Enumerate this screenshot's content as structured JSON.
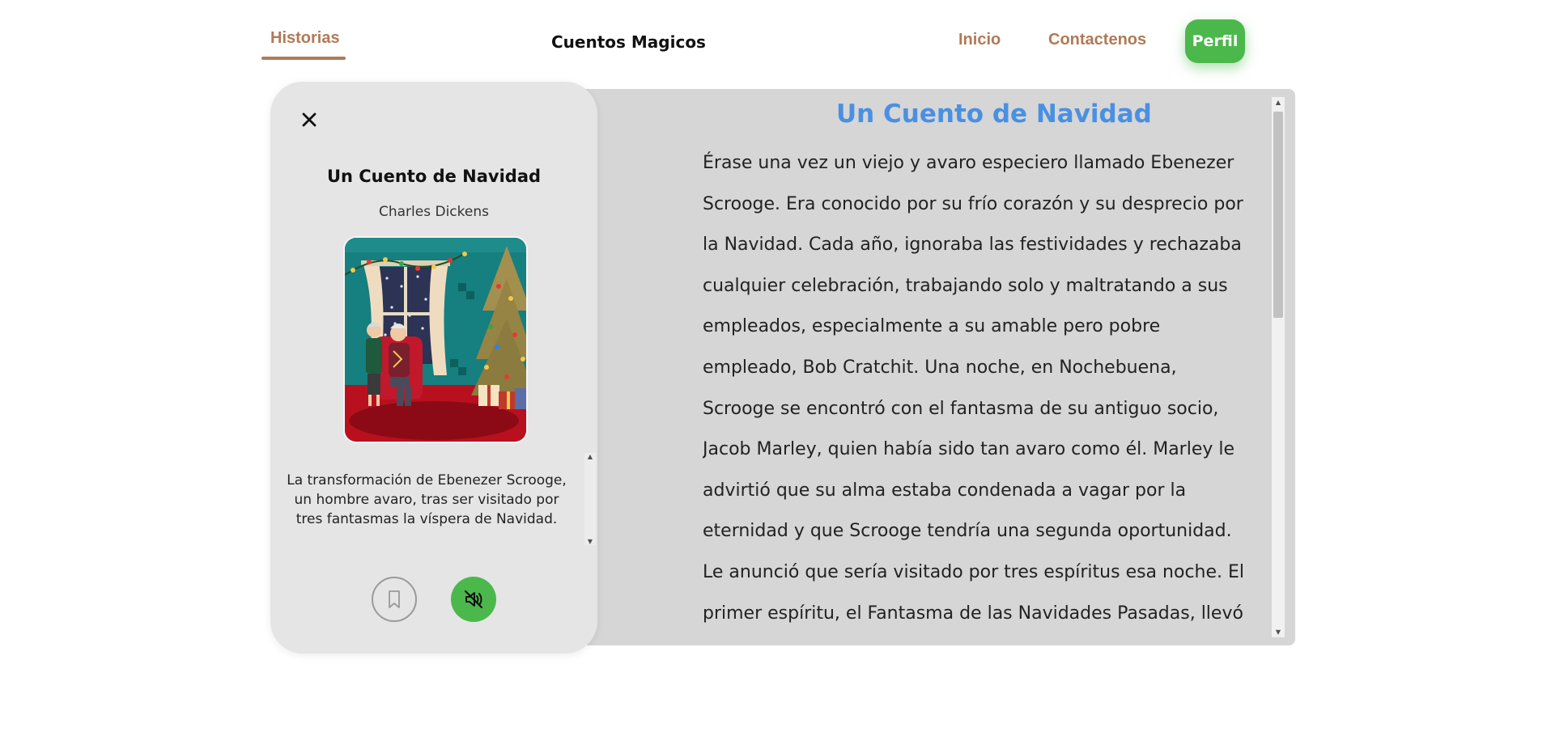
{
  "nav": {
    "historias": "Historias",
    "brand": "Cuentos Magicos",
    "inicio": "Inicio",
    "contactenos": "Contactenos",
    "perfil": "Perfil"
  },
  "colors": {
    "accent_brown": "#b07a55",
    "accent_green": "#4bb84b",
    "title_blue": "#4a90e2",
    "card_bg": "#e5e5e5",
    "panel_bg": "#d6d6d6"
  },
  "card": {
    "close_icon": "close-icon",
    "title": "Un Cuento de Navidad",
    "author": "Charles Dickens",
    "cover_icon": "book-cover-illustration",
    "description": "La transformación de Ebenezer Scrooge, un hombre avaro, tras ser visitado por tres fantasmas la víspera de Navidad.",
    "bookmark_icon": "bookmark-icon",
    "audio_icon": "speaker-muted-icon"
  },
  "story": {
    "title": "Un Cuento de Navidad",
    "text": "Érase una vez un viejo y avaro especiero llamado Ebenezer Scrooge. Era conocido por su frío corazón y su desprecio por la Navidad. Cada año, ignoraba las festividades y rechazaba cualquier celebración, trabajando solo y maltratando a sus empleados, especialmente a su amable pero pobre empleado, Bob Cratchit. Una noche, en Nochebuena, Scrooge se encontró con el fantasma de su antiguo socio, Jacob Marley, quien había sido tan avaro como él. Marley le advirtió que su alma estaba condenada a vagar por la eternidad y que Scrooge tendría una segunda oportunidad. Le anunció que sería visitado por tres espíritus esa noche. El primer espíritu, el Fantasma de las Navidades Pasadas, llevó a Scrooge a"
  }
}
